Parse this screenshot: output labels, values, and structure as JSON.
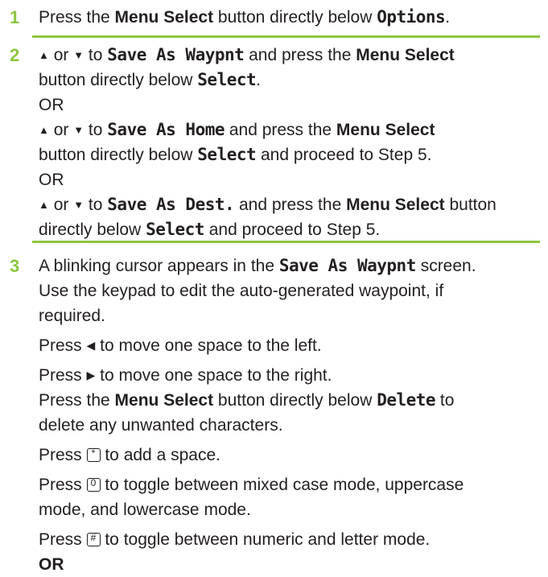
{
  "colors": {
    "accent": "#8dc63f",
    "text": "#231f20"
  },
  "steps": [
    {
      "number": "1",
      "lines": [
        {
          "t1": "Press the ",
          "b1": "Menu Select",
          "t2": " button directly below ",
          "m1": "Options",
          "t3": "."
        }
      ]
    },
    {
      "number": "2",
      "l1": {
        "up": "▲",
        "t1": " or ",
        "down": "▼",
        "t2": " to ",
        "m1": "Save As Waypnt",
        "t3": " and press the ",
        "b1": "Menu Select"
      },
      "l2": {
        "t1": "button directly below ",
        "m1": "Select",
        "t2": "."
      },
      "or1": "OR",
      "l3": {
        "up": "▲",
        "t1": " or ",
        "down": "▼",
        "t2": " to ",
        "m1": "Save As Home",
        "t3": " and press the ",
        "b1": "Menu Select"
      },
      "l4": {
        "t1": "button directly below ",
        "m1": "Select",
        "t2": " and proceed to Step 5."
      },
      "or2": "OR",
      "l5": {
        "up": "▲",
        "t1": " or ",
        "down": "▼",
        "t2": " to ",
        "m1": "Save As Dest.",
        "t3": " and press the ",
        "b1": "Menu Select",
        "t4": " button"
      },
      "l6": {
        "t1": "directly below ",
        "m1": "Select",
        "t2": " and proceed to Step 5."
      }
    },
    {
      "number": "3",
      "l1": {
        "t1": "A blinking cursor appears in the ",
        "m1": "Save As Waypnt",
        "t2": " screen."
      },
      "l2": "Use the keypad to edit the auto-generated waypoint, if",
      "l3": "required.",
      "l4": {
        "t1": "Press ",
        "icon": "◀",
        "t2": " to move one space to the left."
      },
      "l5": {
        "t1": "Press ",
        "icon": "▶",
        "t2": " to move one space to the right."
      },
      "l6": {
        "t1": "Press the ",
        "b1": "Menu Select",
        "t2": " button directly below ",
        "m1": "Delete",
        "t3": " to"
      },
      "l7": "delete any unwanted characters.",
      "l8": {
        "t1": "Press ",
        "key": "*",
        "t2": " to add a space."
      },
      "l9": {
        "t1": "Press ",
        "key": "0",
        "t2": " to toggle between mixed case mode, uppercase"
      },
      "l10": "mode, and lowercase mode.",
      "l11": {
        "t1": "Press ",
        "key": "#",
        "t2": " to toggle between numeric and letter mode."
      },
      "or": "OR"
    }
  ]
}
